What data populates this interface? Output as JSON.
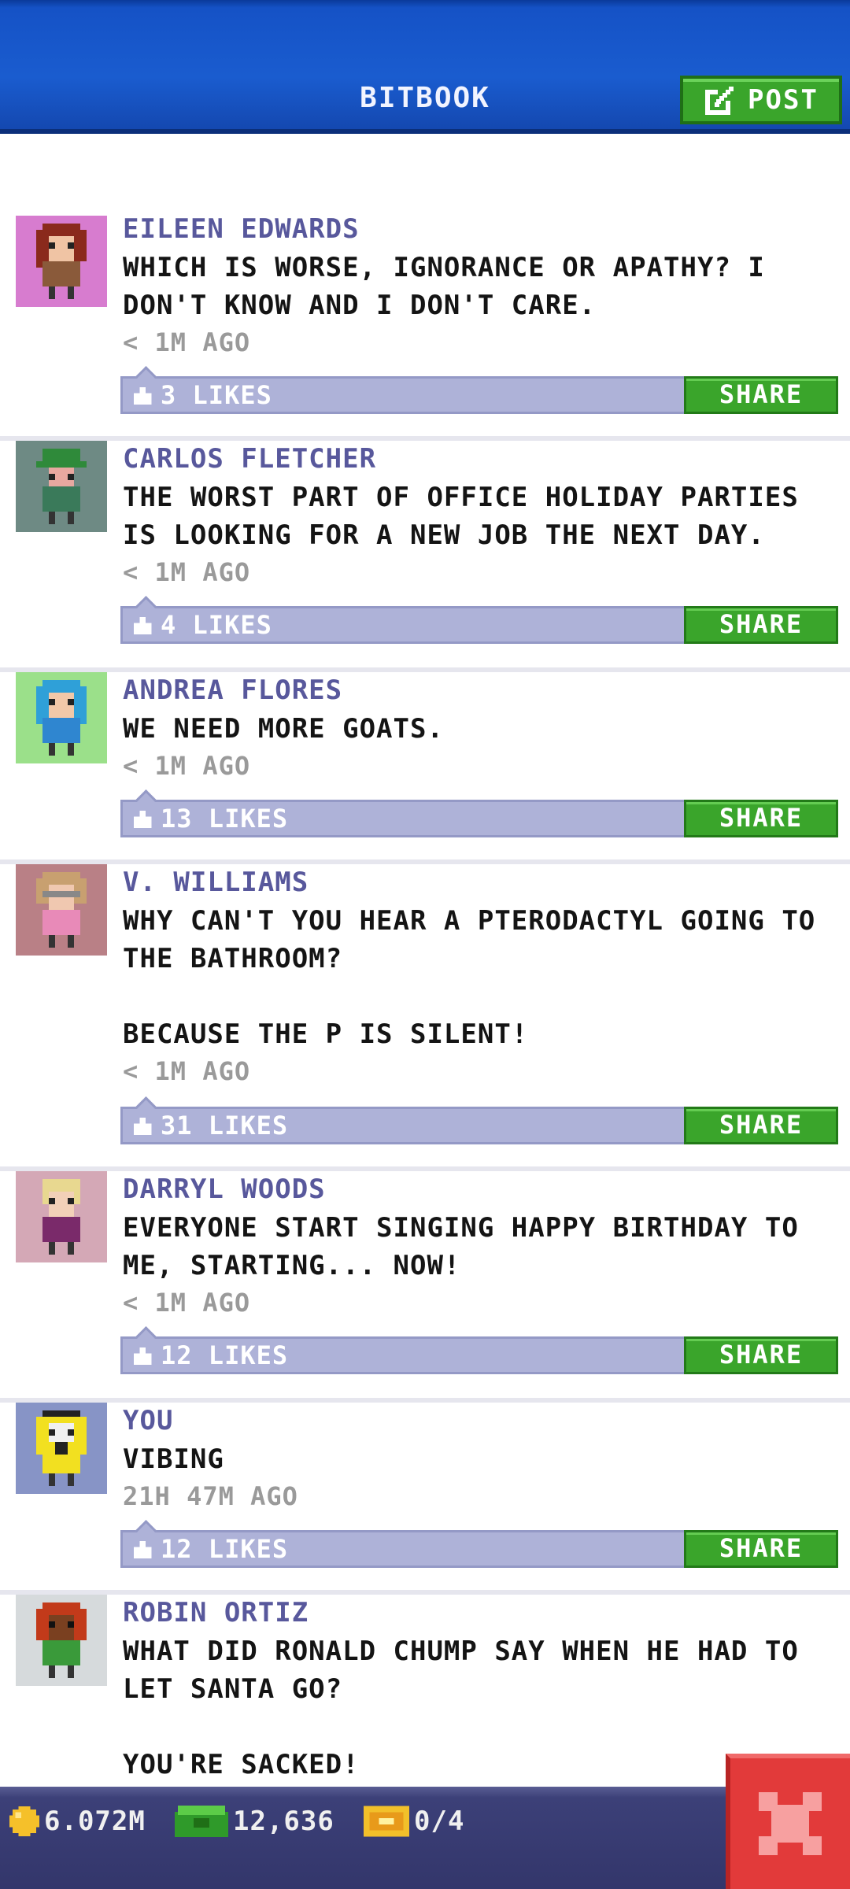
{
  "header": {
    "title": "BITBOOK",
    "post_label": "POST"
  },
  "posts": [
    {
      "author": "EILEEN EDWARDS",
      "text": "WHICH IS WORSE, IGNORANCE OR APATHY? I DON'T KNOW AND I DON'T CARE.",
      "time": "< 1M AGO",
      "likes": "3 LIKES",
      "share": "SHARE",
      "avatar_bg": "#d77ccf",
      "avatar_icon": "avatar-red-hair"
    },
    {
      "author": "CARLOS FLETCHER",
      "text": "THE WORST PART OF OFFICE HOLIDAY PARTIES IS LOOKING FOR A NEW JOB THE NEXT DAY.",
      "time": "< 1M AGO",
      "likes": "4 LIKES",
      "share": "SHARE",
      "avatar_bg": "#6e8a84",
      "avatar_icon": "avatar-green-cap"
    },
    {
      "author": "ANDREA FLORES",
      "text": "WE NEED MORE GOATS.",
      "time": "< 1M AGO",
      "likes": "13 LIKES",
      "share": "SHARE",
      "avatar_bg": "#9be08a",
      "avatar_icon": "avatar-blue-hood"
    },
    {
      "author": "V. WILLIAMS",
      "text": "WHY CAN'T YOU HEAR A PTERODACTYL GOING TO THE BATHROOM?\n\nBECAUSE THE P IS SILENT!",
      "time": "< 1M AGO",
      "likes": "31 LIKES",
      "share": "SHARE",
      "avatar_bg": "#b98086",
      "avatar_icon": "avatar-glasses"
    },
    {
      "author": "DARRYL WOODS",
      "text": "EVERYONE START SINGING HAPPY BIRTHDAY TO ME, STARTING... NOW!",
      "time": "< 1M AGO",
      "likes": "12 LIKES",
      "share": "SHARE",
      "avatar_bg": "#d4a8b6",
      "avatar_icon": "avatar-blonde"
    },
    {
      "author": "YOU",
      "text": "VIBING",
      "time": "21H 47M AGO",
      "likes": "12 LIKES",
      "share": "SHARE",
      "avatar_bg": "#8794c6",
      "avatar_icon": "avatar-yellow-hazmat"
    },
    {
      "author": "ROBIN ORTIZ",
      "text": "WHAT DID RONALD CHUMP SAY WHEN HE HAD TO LET SANTA GO?\n\nYOU'RE SACKED!",
      "time": "",
      "likes": "",
      "share": "",
      "avatar_bg": "#d6dadc",
      "avatar_icon": "avatar-red-hair-dark"
    }
  ],
  "bottom_bar": {
    "coins": "6.072M",
    "bux": "12,636",
    "tickets": "0/4"
  },
  "colors": {
    "header": "#1a5ccf",
    "share": "#3aa52b",
    "likes_bar": "#aeb2d8",
    "author": "#58589c",
    "close": "#e23a3a"
  }
}
